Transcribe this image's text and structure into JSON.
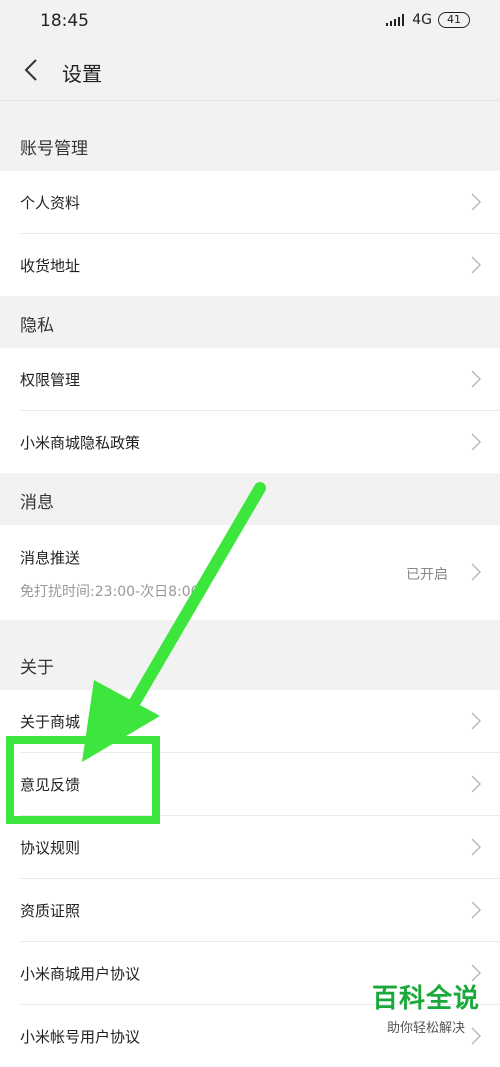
{
  "status": {
    "time": "18:45",
    "network": "4G",
    "battery": "41"
  },
  "header": {
    "title": "设置"
  },
  "sections": [
    {
      "title": "账号管理",
      "items": [
        {
          "label": "个人资料"
        },
        {
          "label": "收货地址"
        }
      ]
    },
    {
      "title": "隐私",
      "items": [
        {
          "label": "权限管理"
        },
        {
          "label": "小米商城隐私政策"
        }
      ]
    },
    {
      "title": "消息",
      "items": [
        {
          "label": "消息推送",
          "sub": "免打扰时间:23:00-次日8:00",
          "value": "已开启"
        }
      ]
    },
    {
      "title": "关于",
      "items": [
        {
          "label": "关于商城"
        },
        {
          "label": "意见反馈"
        },
        {
          "label": "协议规则"
        },
        {
          "label": "资质证照"
        },
        {
          "label": "小米商城用户协议"
        },
        {
          "label": "小米帐号用户协议"
        }
      ]
    }
  ],
  "annotation": {
    "color": "#3ce63c"
  },
  "watermark": {
    "brand": "百科全说",
    "slogan": "助你轻松解决"
  }
}
